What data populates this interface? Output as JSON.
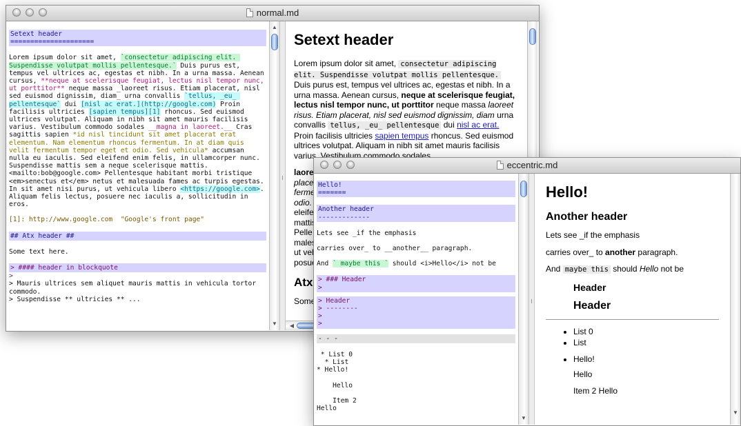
{
  "window1": {
    "title": "normal.md",
    "source": {
      "setext": "Setext header\n=====================",
      "para_parts": [
        "Lorem ipsum dolor sit amet, ",
        "`consectetur adipiscing elit. Suspendisse volutpat mollis pellentesque.`",
        " Duis purus est, tempus vel ultrices ac, egestas et nibh. In a urna massa. Aenean cursus, ",
        "**neque at scelerisque feugiat, lectus nisl tempor nunc, ut porttitor**",
        " neque massa _laoreet risus. Etiam placerat, nisl sed euismod dignissim, diam_ urna convallis ",
        "`tellus, _eu_ pellentesque`",
        " dui ",
        "[nisl ac erat.](http://google.com)",
        " Proin facilisis ultricies ",
        "[sapien tempus][1]",
        " rhoncus. Sed euismod ultrices volutpat. Aliquam in nibh sit amet mauris facilisis varius. Vestibulum commodo sodales ",
        "__magna in laoreet.__",
        " Cras sagittis sapien ",
        "*id nisl tincidunt sit amet placerat erat elementum. Nam elementum rhoncus fermentum. In at diam quis velit fermentum tempor eget et odio. Sed vehicula*",
        " accumsan nulla eu iaculis. Sed eleifend enim felis, in ullamcorper nunc. Suspendisse mattis sem a neque scelerisque mattis. <mailto:bob@google.com> Pellentesque habitant morbi tristique <em>senectus et</em> netus et malesuada fames ac turpis egestas. In sit amet nisi purus, ut vehicula libero ",
        "<https://google.com>",
        ". Aliquam felis lectus, posuere nec iaculis a, sollicitudin in eros."
      ],
      "reference": "[1]: http://www.google.com  \"Google's front page\"",
      "atx": "## Atx header ##",
      "some_text": "Some text here.",
      "bq1": "> #### header in blockquote",
      "bq2": ">",
      "bq3": "> Mauris ultrices sem aliquet mauris mattis in vehicula tortor commodo.",
      "bq4": "> Suspendisse ** ultricies ** ..."
    },
    "preview": {
      "h1": "Setext header",
      "p_parts": [
        "Lorem ipsum dolor sit amet, ",
        "consectetur adipiscing elit. Suspendisse volutpat mollis pellentesque.",
        " Duis purus est, tempus vel ultrices ac, egestas et nibh. In a urna massa. Aenean cursus, ",
        "neque at scelerisque feugiat, lectus nisl tempor nunc, ut porttitor",
        " neque massa ",
        "laoreet risus. Etiam placerat, nisl sed euismod dignissim, diam",
        " urna convallis ",
        "tellus, _eu_ pellentesque",
        " dui ",
        "nisl ac erat.",
        " Proin facilisis ultricies ",
        "sapien tempus",
        " rhoncus. Sed euismod ultrices volutpat. Aliquam in nibh sit amet mauris facilisis varius. Vestibulum commodo sodales "
      ],
      "tail_lines": [
        "laore",
        "place",
        "ferme",
        "odio.",
        "eleife",
        "mattis",
        "Pelle",
        "males",
        "ut veh",
        "posue"
      ],
      "h2": "Atx",
      "some": "Some"
    }
  },
  "window2": {
    "title": "eccentric.md",
    "source": {
      "hello": "Hello!\n=======",
      "another": "Another header\n-------------",
      "lets_see": "Lets see _if the emphasis",
      "carries": "carries over_ to __another__ paragraph.",
      "and_parts": [
        "And ",
        "` maybe this `",
        " should <i>Hello</i> not be"
      ],
      "bq_header": "> ### Header\n>",
      "bq_setext": "> Header\n> --------\n>\n>",
      "hr": "- - -",
      "list": " * List 0\n  * List\n* Hello!\n\n    Hello\n\n    Item 2\nHello"
    },
    "preview": {
      "h1": "Hello!",
      "h2": "Another header",
      "p1": "Lets see _if the emphasis",
      "p2_a": "carries over_ to ",
      "p2_b": "another",
      "p2_c": " paragraph.",
      "p3_a": "And ",
      "p3_code": "maybe this",
      "p3_b": " should ",
      "p3_em": "Hello",
      "p3_c": " not be",
      "bq_h1": "Header",
      "bq_h2": "Header",
      "li0": "List 0",
      "li1": "List",
      "li2": "Hello!",
      "p_hello": "Hello",
      "p_item": "Item 2 Hello"
    }
  }
}
